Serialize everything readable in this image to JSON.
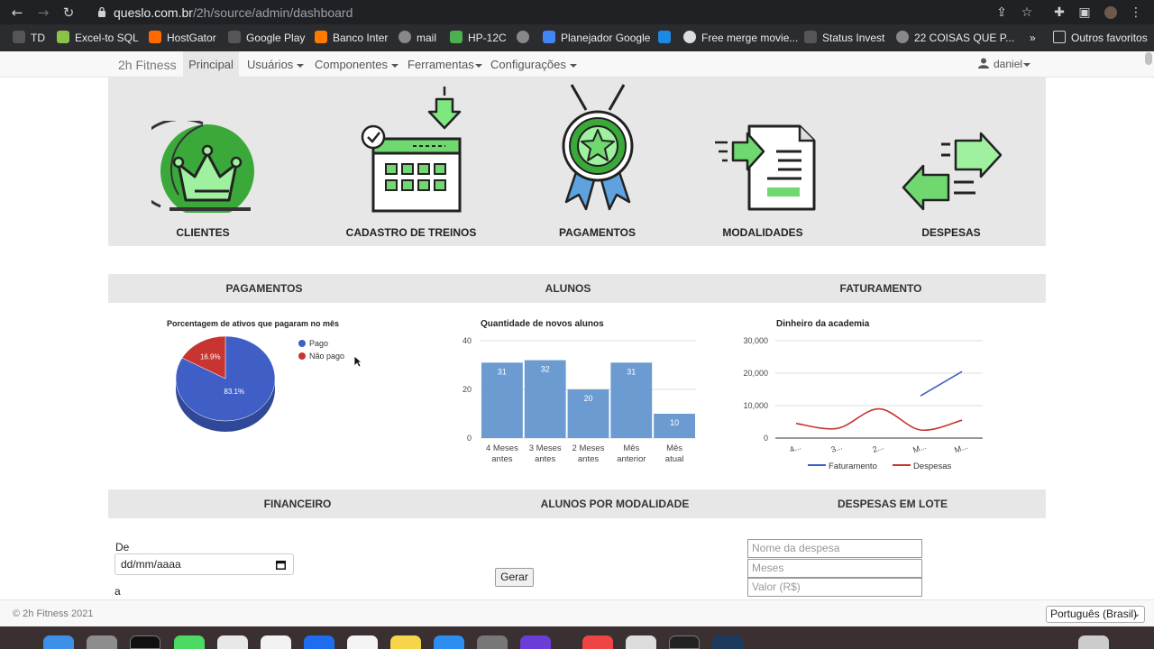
{
  "browser": {
    "url_host": "queslo.com.br",
    "url_path": "/2h/source/admin/dashboard",
    "bookmarks": [
      {
        "label": "TD",
        "color": "#555"
      },
      {
        "label": "Excel-to SQL",
        "color": "#8bc34a"
      },
      {
        "label": "HostGator",
        "color": "#ff6a00"
      },
      {
        "label": "Google Play",
        "color": "#555"
      },
      {
        "label": "Banco Inter",
        "color": "#ff7a00"
      },
      {
        "label": "mail",
        "color": "#888"
      },
      {
        "label": "HP-12C",
        "color": "#4caf50"
      },
      {
        "label": "",
        "color": "#888"
      },
      {
        "label": "Planejador Google",
        "color": "#4285f4"
      },
      {
        "label": "",
        "color": "#1e88e5"
      },
      {
        "label": "Free merge movie...",
        "color": "#ddd"
      },
      {
        "label": "Status Invest",
        "color": "#555"
      },
      {
        "label": "22 COISAS QUE P...",
        "color": "#888"
      }
    ],
    "more_bookmarks": "»",
    "other_favorites": "Outros favoritos"
  },
  "navbar": {
    "brand": "2h Fitness",
    "principal": "Principal",
    "items": [
      "Usuários",
      "Componentes",
      "Ferramentas",
      "Configurações"
    ],
    "user": "daniel"
  },
  "tiles": [
    {
      "label": "CLIENTES",
      "icon": "crown-icon"
    },
    {
      "label": "CADASTRO DE TREINOS",
      "icon": "calendar-icon"
    },
    {
      "label": "PAGAMENTOS",
      "icon": "medal-icon"
    },
    {
      "label": "MODALIDADES",
      "icon": "document-icon"
    },
    {
      "label": "DESPESAS",
      "icon": "arrows-icon"
    }
  ],
  "sections_row1": [
    "PAGAMENTOS",
    "ALUNOS",
    "FATURAMENTO"
  ],
  "sections_row2": [
    "FINANCEIRO",
    "ALUNOS POR MODALIDADE",
    "DESPESAS EM LOTE"
  ],
  "chart_data": [
    {
      "type": "pie",
      "title": "Porcentagem de ativos que pagaram no mês",
      "labels": [
        "Pago",
        "Não pago"
      ],
      "values": [
        83.1,
        16.9
      ],
      "value_labels": [
        "83.1%",
        "16.9%"
      ],
      "colors": [
        "#3f5fc6",
        "#c8342f"
      ],
      "legend": "right"
    },
    {
      "type": "bar",
      "title": "Quantidade de novos alunos",
      "categories": [
        [
          "4 Meses",
          "antes"
        ],
        [
          "3 Meses",
          "antes"
        ],
        [
          "2 Meses",
          "antes"
        ],
        [
          "Mês",
          "anterior"
        ],
        [
          "Mês",
          "atual"
        ]
      ],
      "values": [
        31,
        32,
        20,
        31,
        10
      ],
      "ylim": [
        0,
        40
      ],
      "yticks": [
        "0",
        "20",
        "40"
      ],
      "color": "#6b9bd1"
    },
    {
      "type": "line",
      "title": "Dinheiro da academia",
      "categories": [
        "4...",
        "3...",
        "2...",
        "M...",
        "M..."
      ],
      "ylim": [
        0,
        30000
      ],
      "yticks": [
        "0",
        "10,000",
        "20,000",
        "30,000"
      ],
      "series": [
        {
          "name": "Faturamento",
          "color": "#3f5fc6",
          "values": [
            null,
            null,
            null,
            13000,
            20500
          ]
        },
        {
          "name": "Despesas",
          "color": "#c8342f",
          "values": [
            4500,
            3000,
            9000,
            2500,
            5500
          ]
        }
      ],
      "legend": "bottom"
    }
  ],
  "financeiro": {
    "de_label": "De",
    "date_placeholder": "dd/mm/aaaa",
    "a_label": "a"
  },
  "gerar_label": "Gerar",
  "despesas_lote": {
    "placeholders": [
      "Nome da despesa",
      "Meses",
      "Valor (R$)"
    ]
  },
  "footer": {
    "copyright": "© 2h Fitness 2021",
    "language": "Português (Brasil)"
  }
}
